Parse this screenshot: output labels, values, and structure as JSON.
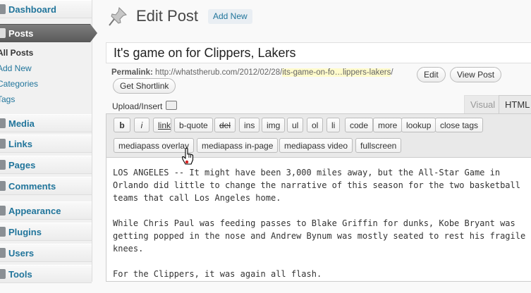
{
  "sidebar": {
    "items": [
      {
        "label": "Dashboard",
        "icon": "dashboard-icon"
      },
      {
        "label": "Posts",
        "icon": "posts-icon",
        "active": true
      },
      {
        "label": "Media",
        "icon": "media-icon"
      },
      {
        "label": "Links",
        "icon": "links-icon"
      },
      {
        "label": "Pages",
        "icon": "pages-icon"
      },
      {
        "label": "Comments",
        "icon": "comments-icon"
      },
      {
        "label": "Appearance",
        "icon": "appearance-icon"
      },
      {
        "label": "Plugins",
        "icon": "plugins-icon"
      },
      {
        "label": "Users",
        "icon": "users-icon"
      },
      {
        "label": "Tools",
        "icon": "tools-icon"
      }
    ],
    "submenu": [
      "All Posts",
      "Add New",
      "Categories",
      "Tags"
    ]
  },
  "header": {
    "title": "Edit Post",
    "add_new": "Add New"
  },
  "post": {
    "title": "It's game on for Clippers, Lakers"
  },
  "permalink": {
    "label": "Permalink:",
    "base": "http://whatstherub.com/2012/02/28/",
    "slug": "its-game-on-fo…lippers-lakers",
    "slash": "/",
    "edit": "Edit",
    "view": "View Post",
    "shortlink": "Get Shortlink"
  },
  "upload": {
    "label": "Upload/Insert"
  },
  "tabs": {
    "visual": "Visual",
    "html": "HTML"
  },
  "toolbar": {
    "row1": [
      "b",
      "i",
      "link",
      "b-quote",
      "del",
      "ins",
      "img",
      "ul",
      "ol",
      "li",
      "code",
      "more",
      "lookup",
      "close tags"
    ],
    "row2": [
      "mediapass overlay",
      "mediapass in-page",
      "mediapass video",
      "fullscreen"
    ]
  },
  "content": {
    "paragraphs": [
      "LOS ANGELES -- It might have been 3,000 miles away, but the All-Star Game in Orlando did little to change the narrative of this season for the two basketball teams that call Los Angeles home.",
      "While Chris Paul was feeding passes to Blake Griffin for dunks, Kobe Bryant was getting popped in the nose and Andrew Bynum was mostly seated to rest his fragile knees.",
      "For the Clippers, it was again all flash."
    ]
  },
  "colors": {
    "link": "#21759b",
    "active_menu": "#6d6d6d",
    "slug_highlight": "#fffbcc"
  }
}
